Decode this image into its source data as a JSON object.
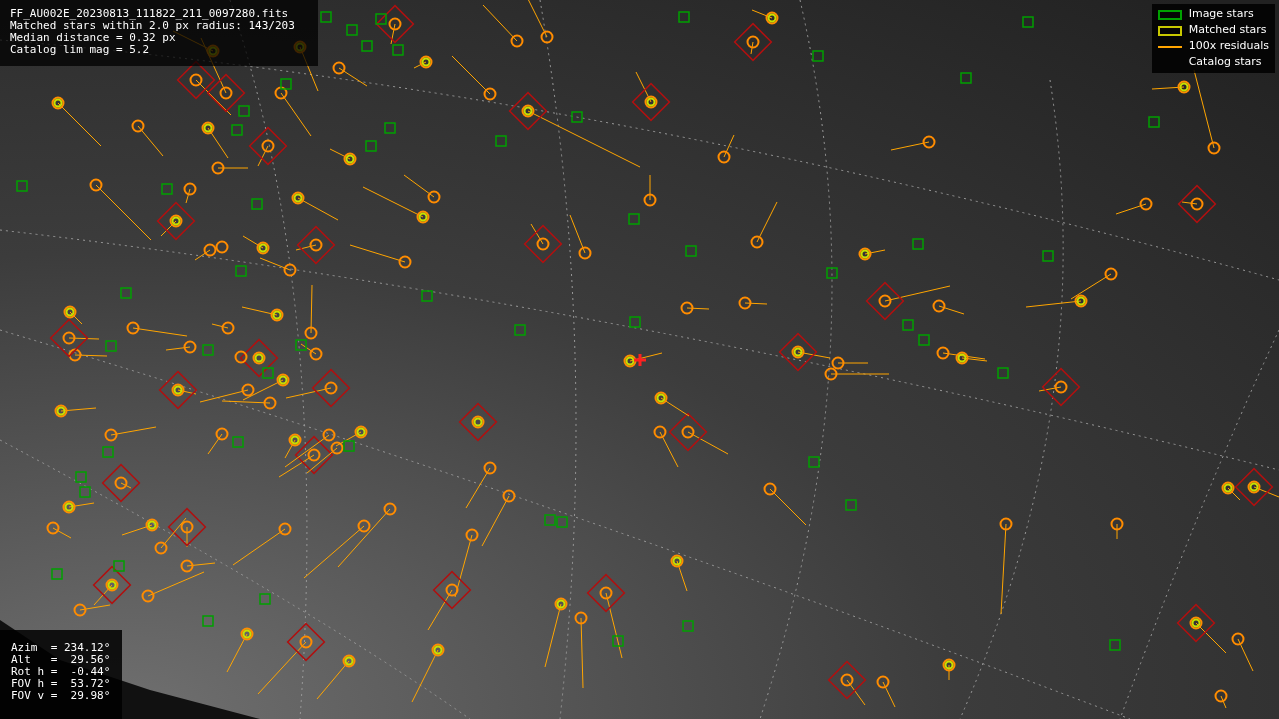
{
  "info_top": [
    "FF_AU002E_20230813_111822_211_0097280.fits",
    "Matched stars within 2.0 px radius: 143/203",
    "Median distance = 0.32 px",
    "Catalog lim mag = 5.2"
  ],
  "legend": [
    {
      "kind": "box",
      "color": "#00a000",
      "label": "Image stars"
    },
    {
      "kind": "box",
      "color": "#c8c800",
      "label": "Matched stars"
    },
    {
      "kind": "line",
      "color": "#ffa500",
      "label": "100x residuals"
    },
    {
      "kind": "text",
      "label": "Catalog stars"
    }
  ],
  "info_bottom": [
    "Azim  = 234.12°",
    "Alt   =  29.56°",
    "Rot h =  -0.44°",
    "FOV h =  53.72°",
    "FOV v =  29.98°"
  ]
}
